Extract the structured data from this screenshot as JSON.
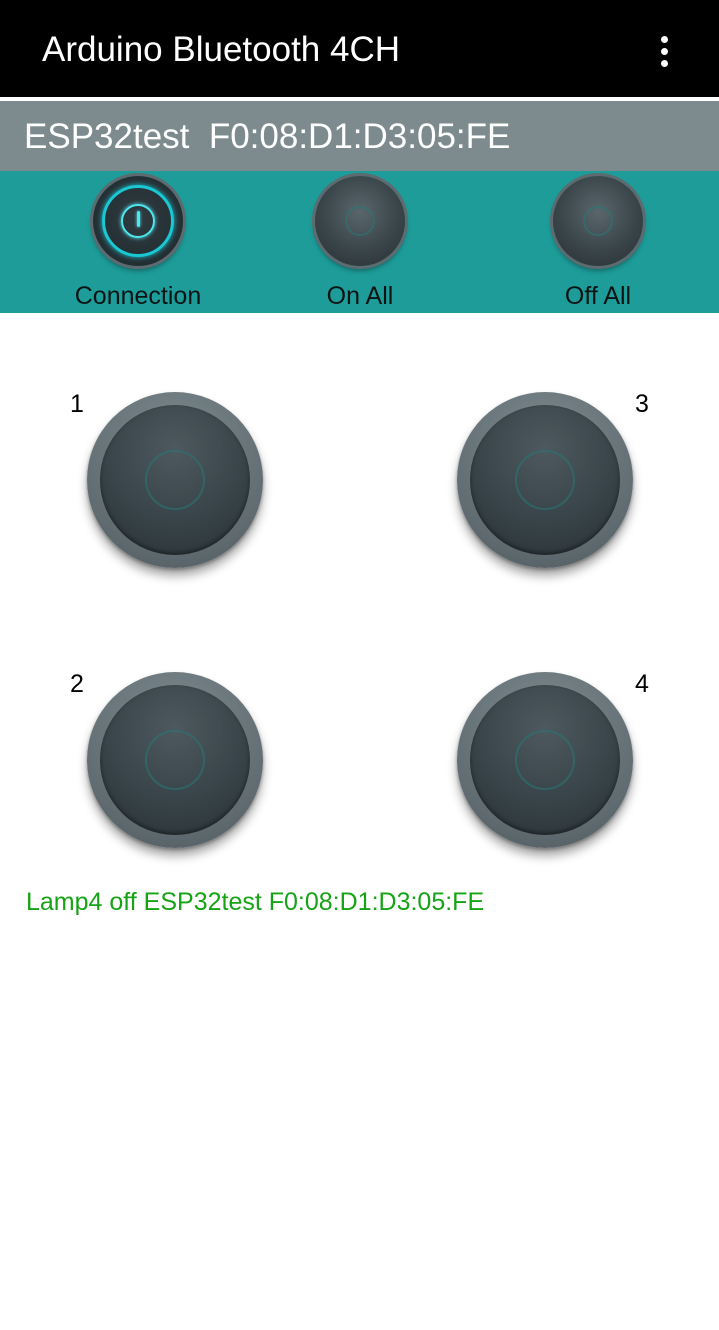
{
  "app_bar": {
    "title": "Arduino Bluetooth 4CH",
    "overflow_icon": "more-vert-icon"
  },
  "device": {
    "text": "ESP32test  F0:08:D1:D3:05:FE"
  },
  "controls": [
    {
      "label": "Connection",
      "icon": "power-icon",
      "active": true
    },
    {
      "label": "On All",
      "icon": "knob-icon",
      "active": false
    },
    {
      "label": "Off All",
      "icon": "knob-icon",
      "active": false
    }
  ],
  "lamps": [
    {
      "number": "1"
    },
    {
      "number": "2"
    },
    {
      "number": "3"
    },
    {
      "number": "4"
    }
  ],
  "status": {
    "text": "Lamp4 off ESP32test F0:08:D1:D3:05:FE"
  },
  "colors": {
    "app_bar": "#000000",
    "device_bar": "#7d8b8e",
    "control_bar": "#1d9c99",
    "status_text": "#16a315",
    "glow": "#19c8d3"
  }
}
